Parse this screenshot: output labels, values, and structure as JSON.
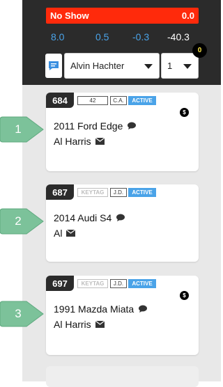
{
  "header": {
    "no_show_label": "No Show",
    "no_show_value": "0.0",
    "stats": [
      "8.0",
      "0.5",
      "-0.3",
      "-40.3"
    ],
    "advisor_select": "Alvin Hachter",
    "count_select": "1",
    "notification_count": "0"
  },
  "cards": [
    {
      "number": "684",
      "tag1": "42",
      "tag2": "C.A.",
      "status": "ACTIVE",
      "vehicle": "2011 Ford Edge",
      "customer": "Al Harris",
      "has_payment": true
    },
    {
      "number": "687",
      "tag1": "KEYTAG",
      "tag2": "J.D.",
      "status": "ACTIVE",
      "vehicle": "2014 Audi S4",
      "customer": "Al",
      "has_payment": false
    },
    {
      "number": "697",
      "tag1": "KEYTAG",
      "tag2": "J.D.",
      "status": "ACTIVE",
      "vehicle": "1991 Mazda Miata",
      "customer": "Al Harris",
      "has_payment": true
    }
  ],
  "callouts": [
    "1",
    "2",
    "3"
  ],
  "payment_icon_symbol": "$",
  "colors": {
    "header_bg": "#2b2b2b",
    "no_show_bg": "#ff2a0b",
    "stat_blue": "#4aa3e8",
    "active_blue": "#4aa3e8",
    "callout_green": "#7cc29a"
  }
}
